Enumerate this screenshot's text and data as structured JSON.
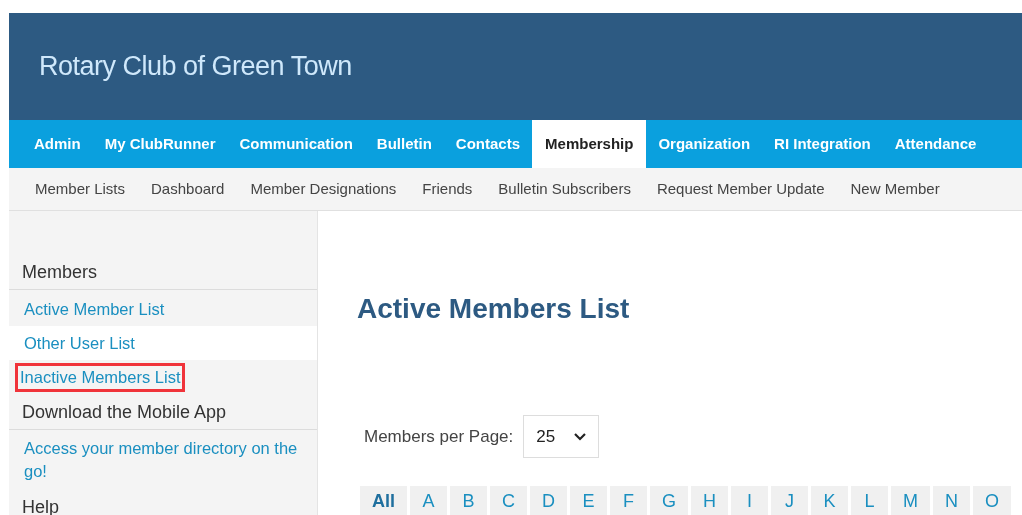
{
  "header": {
    "title": "Rotary Club of Green Town"
  },
  "nav": [
    {
      "label": "Admin",
      "selected": false
    },
    {
      "label": "My ClubRunner",
      "selected": false
    },
    {
      "label": "Communication",
      "selected": false
    },
    {
      "label": "Bulletin",
      "selected": false
    },
    {
      "label": "Contacts",
      "selected": false
    },
    {
      "label": "Membership",
      "selected": true
    },
    {
      "label": "Organization",
      "selected": false
    },
    {
      "label": "RI Integration",
      "selected": false
    },
    {
      "label": "Attendance",
      "selected": false
    }
  ],
  "subnav": [
    "Member Lists",
    "Dashboard",
    "Member Designations",
    "Friends",
    "Bulletin Subscribers",
    "Request Member Update",
    "New Member"
  ],
  "sidebar": [
    {
      "heading": "Members",
      "links": [
        {
          "label": "Active Member List",
          "highlighted": false
        },
        {
          "label": "Other User List",
          "highlighted": false
        },
        {
          "label": "Inactive Members List",
          "highlighted": true
        }
      ]
    },
    {
      "heading": "Download the Mobile App",
      "links": [
        {
          "label": "Access your member directory on the go!",
          "highlighted": false
        }
      ]
    },
    {
      "heading": "Help"
    }
  ],
  "main": {
    "title": "Active Members List",
    "per_page": {
      "label": "Members per Page:",
      "value": "25"
    },
    "letters": [
      {
        "label": "All",
        "selected": true
      },
      {
        "label": "A",
        "selected": false
      },
      {
        "label": "B",
        "selected": false
      },
      {
        "label": "C",
        "selected": false
      },
      {
        "label": "D",
        "selected": false
      },
      {
        "label": "E",
        "selected": false
      },
      {
        "label": "F",
        "selected": false
      },
      {
        "label": "G",
        "selected": false
      },
      {
        "label": "H",
        "selected": false
      },
      {
        "label": "I",
        "selected": false
      },
      {
        "label": "J",
        "selected": false
      },
      {
        "label": "K",
        "selected": false
      },
      {
        "label": "L",
        "selected": false
      },
      {
        "label": "M",
        "selected": false
      },
      {
        "label": "N",
        "selected": false
      },
      {
        "label": "O",
        "selected": false
      }
    ]
  }
}
